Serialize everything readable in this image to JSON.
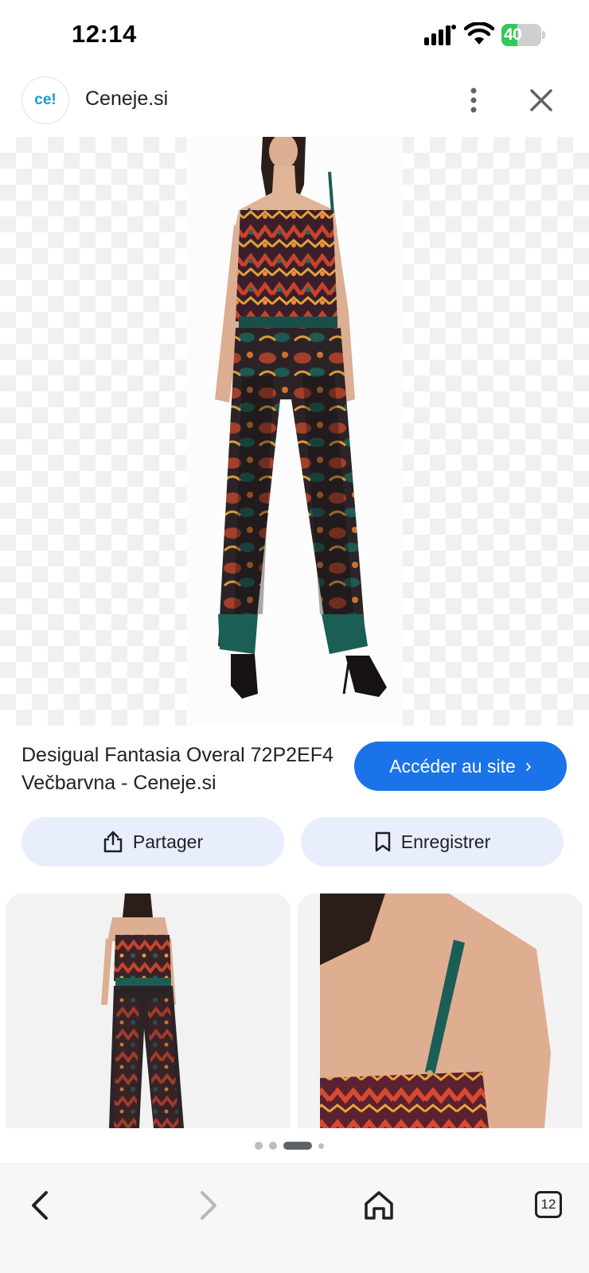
{
  "status_bar": {
    "time": "12:14",
    "battery_percent": "40",
    "battery_level": 0.4,
    "signal_icon": "cellular-signal-icon",
    "wifi_icon": "wifi-icon",
    "battery_icon": "battery-charging-icon"
  },
  "site": {
    "logo_text": "ce!",
    "name": "Ceneje.si"
  },
  "product": {
    "title": "Desigual Fantasia Overal 72P2EF4 Večbarvna - Ceneje.si",
    "visit_label": "Accéder au site",
    "visit_chevron": "›"
  },
  "actions": {
    "share_label": "Partager",
    "save_label": "Enregistrer"
  },
  "carousel": {
    "page_count": 4,
    "active_index": 2
  },
  "browser_nav": {
    "tab_count": "12"
  },
  "colors": {
    "accent": "#1a73e8",
    "chip_bg": "#e8eefc",
    "logo_text": "#1a9ad6",
    "battery_green": "#34c759"
  }
}
